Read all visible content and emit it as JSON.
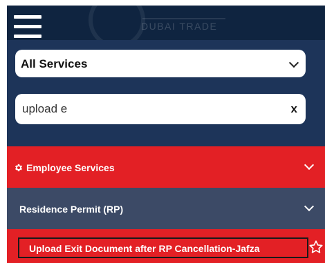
{
  "brand": {
    "logo_text": "DUBAI TRADE"
  },
  "filters": {
    "service_select": "All Services",
    "search_value": "upload e",
    "clear_label": "x"
  },
  "menu": {
    "employee_services": "Employee Services",
    "residence_permit": "Residence Permit (RP)",
    "result_item": "Upload Exit Document after RP Cancellation-Jafza"
  },
  "icons": {
    "menu": "hamburger-icon",
    "settings": "gear-icon",
    "expand": "chevron-down-icon",
    "favorite": "star-outline-icon"
  },
  "colors": {
    "header_bg": "#0f2440",
    "panel_bg": "#1d3459",
    "accent_red": "#e32025",
    "sub_row_bg": "#3c4a66"
  }
}
